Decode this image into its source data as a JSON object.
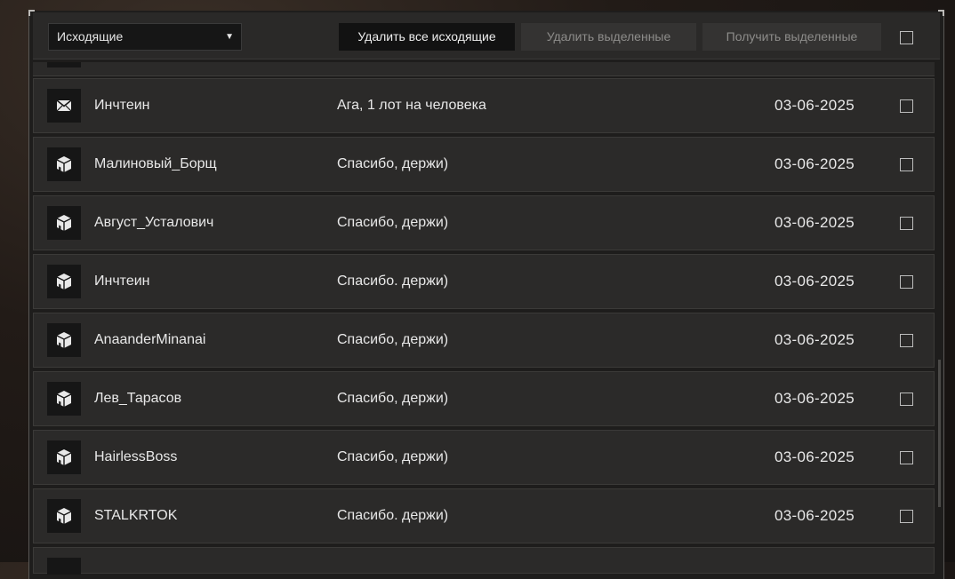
{
  "toolbar": {
    "folder_select": "Исходящие",
    "folder_arrow": "▼",
    "delete_all_label": "Удалить все исходящие",
    "delete_selected_label": "Удалить выделенные",
    "receive_selected_label": "Получить выделенные"
  },
  "messages": [
    {
      "icon": "envelope-icon",
      "sender": "Инчтеин",
      "subject": "Ага, 1 лот на человека",
      "date": "03-06-2025"
    },
    {
      "icon": "package-icon",
      "sender": "Малиновый_Борщ",
      "subject": "Спасибо, держи)",
      "date": "03-06-2025"
    },
    {
      "icon": "package-icon",
      "sender": "Август_Усталович",
      "subject": "Спасибо, держи)",
      "date": "03-06-2025"
    },
    {
      "icon": "package-icon",
      "sender": "Инчтеин",
      "subject": "Спасибо. держи)",
      "date": "03-06-2025"
    },
    {
      "icon": "package-icon",
      "sender": "AnaanderMinanai",
      "subject": "Спасибо, держи)",
      "date": "03-06-2025"
    },
    {
      "icon": "package-icon",
      "sender": "Лев_Тарасов",
      "subject": "Спасибо, держи)",
      "date": "03-06-2025"
    },
    {
      "icon": "package-icon",
      "sender": "HairlessBoss",
      "subject": "Спасибо, держи)",
      "date": "03-06-2025"
    },
    {
      "icon": "package-icon",
      "sender": "STALKRTOK",
      "subject": "Спасибо. держи)",
      "date": "03-06-2025"
    }
  ],
  "colors": {
    "panel_bg": "#1e1d1c",
    "row_bg": "#2b2a29",
    "button_active": "#121212",
    "button_disabled": "#343332",
    "text": "#e8e8e8",
    "text_disabled": "#8d8c8a"
  }
}
